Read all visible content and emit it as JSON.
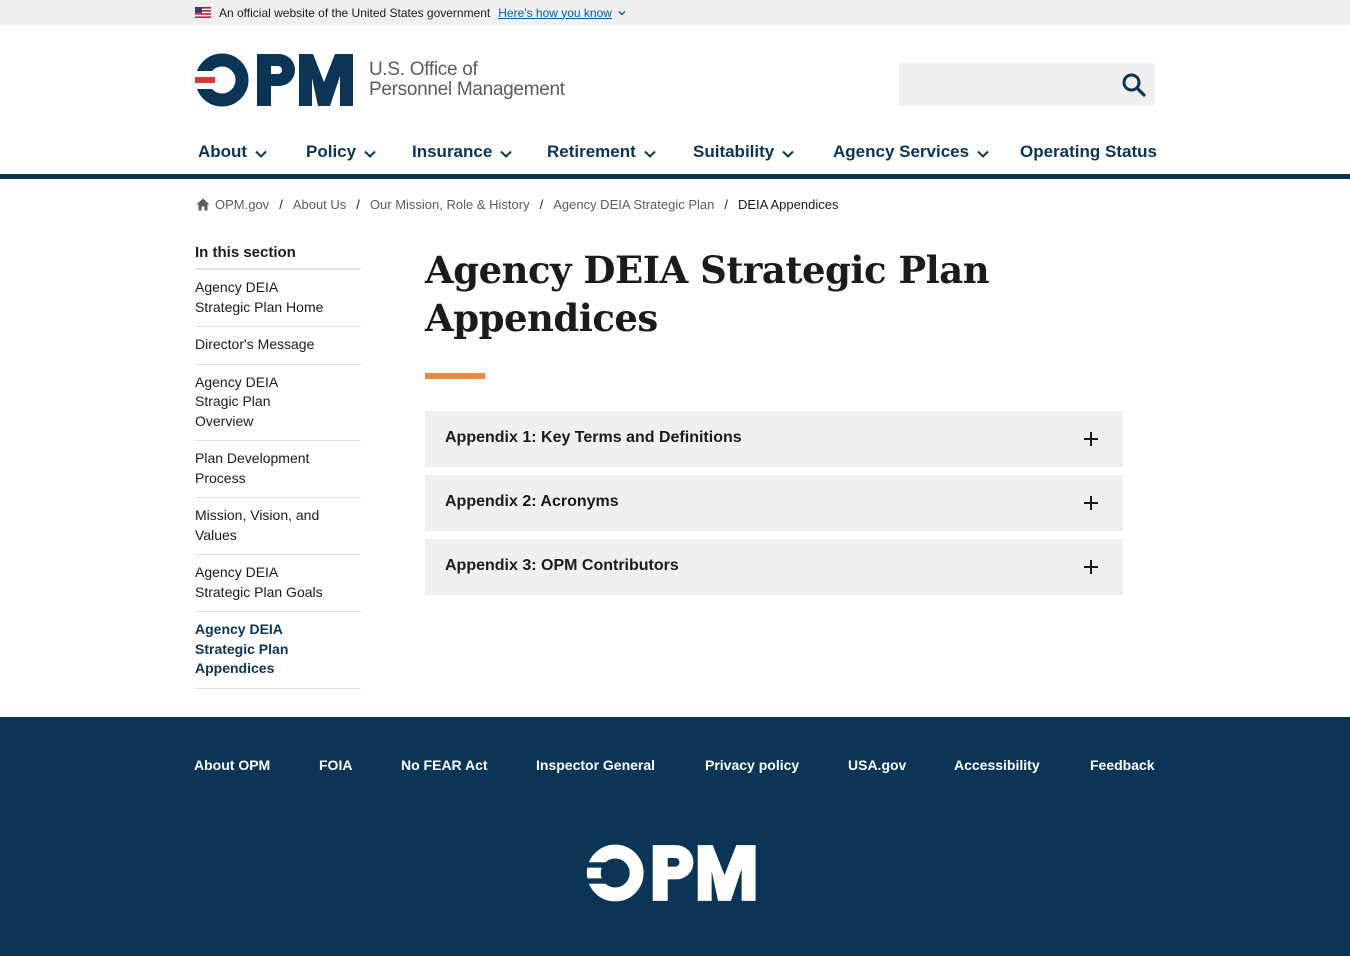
{
  "gov_banner": {
    "text": "An official website of the United States government",
    "link": "Here's how you know",
    "flag_icon": "us-flag-icon"
  },
  "header": {
    "logo_letters": "OPM",
    "logo_line1": "U.S. Office of",
    "logo_line2": "Personnel Management",
    "search_placeholder": "",
    "search_icon": "search-icon"
  },
  "nav": {
    "items": [
      {
        "label": "About",
        "dropdown": true,
        "active": true
      },
      {
        "label": "Policy",
        "dropdown": true
      },
      {
        "label": "Insurance",
        "dropdown": true
      },
      {
        "label": "Retirement",
        "dropdown": true
      },
      {
        "label": "Suitability",
        "dropdown": true
      },
      {
        "label": "Agency Services",
        "dropdown": true
      },
      {
        "label": "Operating Status",
        "dropdown": false
      }
    ]
  },
  "breadcrumb": {
    "items": [
      "OPM.gov",
      "About Us",
      "Our Mission, Role & History",
      "Agency DEIA Strategic Plan"
    ],
    "current": "DEIA Appendices",
    "home_icon": "home-icon"
  },
  "sidenav": {
    "title": "In this section",
    "items": [
      {
        "lines": [
          "Agency DEIA",
          "Strategic Plan Home"
        ]
      },
      {
        "lines": [
          "Director's Message"
        ]
      },
      {
        "lines": [
          "Agency DEIA",
          "Stragic Plan",
          "Overview"
        ]
      },
      {
        "lines": [
          "Plan Development",
          "Process"
        ]
      },
      {
        "lines": [
          "Mission, Vision, and",
          "Values"
        ]
      },
      {
        "lines": [
          "Agency DEIA",
          "Strategic Plan Goals"
        ]
      },
      {
        "lines": [
          "Agency DEIA",
          "Strategic Plan",
          "Appendices"
        ],
        "active": true
      }
    ]
  },
  "main": {
    "title_line1": "Agency DEIA Strategic Plan",
    "title_line2": "Appendices",
    "accordions": [
      {
        "label": "Appendix 1: Key Terms and Definitions",
        "icon": "plus-icon"
      },
      {
        "label": "Appendix 2: Acronyms",
        "icon": "plus-icon"
      },
      {
        "label": "Appendix 3: OPM Contributors",
        "icon": "plus-icon"
      }
    ]
  },
  "footer": {
    "links": [
      "About OPM",
      "FOIA",
      "No FEAR Act",
      "Inspector General",
      "Privacy policy",
      "USA.gov",
      "Accessibility",
      "Feedback"
    ],
    "logo_letters": "OPM"
  },
  "colors": {
    "navy": "#0b3556",
    "accent_teal": "#00a5c8",
    "accent_orange": "#e58b47",
    "logo_red": "#d83933",
    "link_blue": "#005ea2",
    "panel_gray": "#f0f0f0"
  }
}
